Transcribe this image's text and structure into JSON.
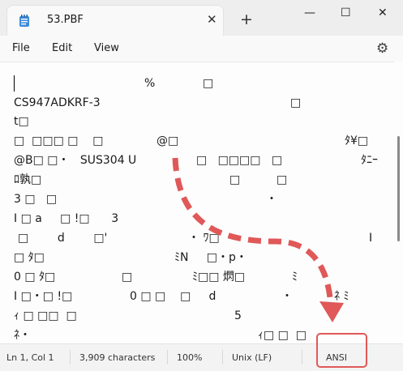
{
  "tab": {
    "title": "53.PBF",
    "close_glyph": "✕",
    "new_tab_glyph": "+"
  },
  "window": {
    "minimize": "—",
    "maximize": "☐",
    "close": "✕"
  },
  "menu": {
    "file": "File",
    "edit": "Edit",
    "view": "View"
  },
  "settings_glyph": "⚙",
  "editor": {
    "fragments": [
      {
        "text": "%"
      },
      {
        "text": "□"
      },
      {
        "text": "CS947ADKRF-3"
      },
      {
        "text": "□"
      },
      {
        "text": "t□"
      },
      {
        "text": "□  □□□ □    □"
      },
      {
        "text": "@□"
      },
      {
        "text": "ﾀ¥□"
      },
      {
        "text": "@B□ □・   SUS304 U"
      },
      {
        "text": "□   □□□□   □"
      },
      {
        "text": "ﾀﾆｰ"
      },
      {
        "text": "ﾛ孰□"
      },
      {
        "text": "□"
      },
      {
        "text": "□"
      },
      {
        "text": "3 □   □"
      },
      {
        "text": "・"
      },
      {
        "text": "I □ a     □ !□      3"
      },
      {
        "text": "□        d        □'"
      },
      {
        "text": "・ ﾜ□"
      },
      {
        "text": "I"
      },
      {
        "text": "□ ﾀ□"
      },
      {
        "text": "ﾐN     □・p・"
      },
      {
        "text": "0 □ ﾀ□"
      },
      {
        "text": "□"
      },
      {
        "text": "ﾐ□□ 熌□"
      },
      {
        "text": "ﾐ"
      },
      {
        "text": "I □・□ !□"
      },
      {
        "text": "0 □ □    □     d"
      },
      {
        "text": "・"
      },
      {
        "text": "ﾈ ﾐ"
      },
      {
        "text": "ｨ □ □□  □"
      },
      {
        "text": "5"
      },
      {
        "text": "ﾈ・"
      },
      {
        "text": "ｨ□ □  □"
      }
    ]
  },
  "status": {
    "position": "Ln 1, Col 1",
    "characters": "3,909 characters",
    "zoom": "100%",
    "line_ending": "Unix (LF)",
    "encoding": "ANSI"
  },
  "annotation": {
    "color": "#e05858"
  }
}
